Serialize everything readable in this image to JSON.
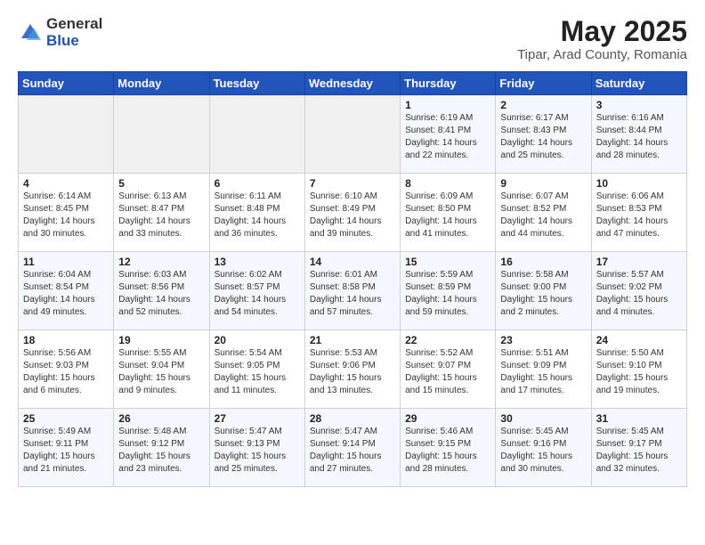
{
  "header": {
    "logo_general": "General",
    "logo_blue": "Blue",
    "title": "May 2025",
    "subtitle": "Tipar, Arad County, Romania"
  },
  "days_of_week": [
    "Sunday",
    "Monday",
    "Tuesday",
    "Wednesday",
    "Thursday",
    "Friday",
    "Saturday"
  ],
  "weeks": [
    {
      "days": [
        {
          "num": "",
          "info": ""
        },
        {
          "num": "",
          "info": ""
        },
        {
          "num": "",
          "info": ""
        },
        {
          "num": "",
          "info": ""
        },
        {
          "num": "1",
          "info": "Sunrise: 6:19 AM\nSunset: 8:41 PM\nDaylight: 14 hours\nand 22 minutes."
        },
        {
          "num": "2",
          "info": "Sunrise: 6:17 AM\nSunset: 8:43 PM\nDaylight: 14 hours\nand 25 minutes."
        },
        {
          "num": "3",
          "info": "Sunrise: 6:16 AM\nSunset: 8:44 PM\nDaylight: 14 hours\nand 28 minutes."
        }
      ]
    },
    {
      "days": [
        {
          "num": "4",
          "info": "Sunrise: 6:14 AM\nSunset: 8:45 PM\nDaylight: 14 hours\nand 30 minutes."
        },
        {
          "num": "5",
          "info": "Sunrise: 6:13 AM\nSunset: 8:47 PM\nDaylight: 14 hours\nand 33 minutes."
        },
        {
          "num": "6",
          "info": "Sunrise: 6:11 AM\nSunset: 8:48 PM\nDaylight: 14 hours\nand 36 minutes."
        },
        {
          "num": "7",
          "info": "Sunrise: 6:10 AM\nSunset: 8:49 PM\nDaylight: 14 hours\nand 39 minutes."
        },
        {
          "num": "8",
          "info": "Sunrise: 6:09 AM\nSunset: 8:50 PM\nDaylight: 14 hours\nand 41 minutes."
        },
        {
          "num": "9",
          "info": "Sunrise: 6:07 AM\nSunset: 8:52 PM\nDaylight: 14 hours\nand 44 minutes."
        },
        {
          "num": "10",
          "info": "Sunrise: 6:06 AM\nSunset: 8:53 PM\nDaylight: 14 hours\nand 47 minutes."
        }
      ]
    },
    {
      "days": [
        {
          "num": "11",
          "info": "Sunrise: 6:04 AM\nSunset: 8:54 PM\nDaylight: 14 hours\nand 49 minutes."
        },
        {
          "num": "12",
          "info": "Sunrise: 6:03 AM\nSunset: 8:56 PM\nDaylight: 14 hours\nand 52 minutes."
        },
        {
          "num": "13",
          "info": "Sunrise: 6:02 AM\nSunset: 8:57 PM\nDaylight: 14 hours\nand 54 minutes."
        },
        {
          "num": "14",
          "info": "Sunrise: 6:01 AM\nSunset: 8:58 PM\nDaylight: 14 hours\nand 57 minutes."
        },
        {
          "num": "15",
          "info": "Sunrise: 5:59 AM\nSunset: 8:59 PM\nDaylight: 14 hours\nand 59 minutes."
        },
        {
          "num": "16",
          "info": "Sunrise: 5:58 AM\nSunset: 9:00 PM\nDaylight: 15 hours\nand 2 minutes."
        },
        {
          "num": "17",
          "info": "Sunrise: 5:57 AM\nSunset: 9:02 PM\nDaylight: 15 hours\nand 4 minutes."
        }
      ]
    },
    {
      "days": [
        {
          "num": "18",
          "info": "Sunrise: 5:56 AM\nSunset: 9:03 PM\nDaylight: 15 hours\nand 6 minutes."
        },
        {
          "num": "19",
          "info": "Sunrise: 5:55 AM\nSunset: 9:04 PM\nDaylight: 15 hours\nand 9 minutes."
        },
        {
          "num": "20",
          "info": "Sunrise: 5:54 AM\nSunset: 9:05 PM\nDaylight: 15 hours\nand 11 minutes."
        },
        {
          "num": "21",
          "info": "Sunrise: 5:53 AM\nSunset: 9:06 PM\nDaylight: 15 hours\nand 13 minutes."
        },
        {
          "num": "22",
          "info": "Sunrise: 5:52 AM\nSunset: 9:07 PM\nDaylight: 15 hours\nand 15 minutes."
        },
        {
          "num": "23",
          "info": "Sunrise: 5:51 AM\nSunset: 9:09 PM\nDaylight: 15 hours\nand 17 minutes."
        },
        {
          "num": "24",
          "info": "Sunrise: 5:50 AM\nSunset: 9:10 PM\nDaylight: 15 hours\nand 19 minutes."
        }
      ]
    },
    {
      "days": [
        {
          "num": "25",
          "info": "Sunrise: 5:49 AM\nSunset: 9:11 PM\nDaylight: 15 hours\nand 21 minutes."
        },
        {
          "num": "26",
          "info": "Sunrise: 5:48 AM\nSunset: 9:12 PM\nDaylight: 15 hours\nand 23 minutes."
        },
        {
          "num": "27",
          "info": "Sunrise: 5:47 AM\nSunset: 9:13 PM\nDaylight: 15 hours\nand 25 minutes."
        },
        {
          "num": "28",
          "info": "Sunrise: 5:47 AM\nSunset: 9:14 PM\nDaylight: 15 hours\nand 27 minutes."
        },
        {
          "num": "29",
          "info": "Sunrise: 5:46 AM\nSunset: 9:15 PM\nDaylight: 15 hours\nand 28 minutes."
        },
        {
          "num": "30",
          "info": "Sunrise: 5:45 AM\nSunset: 9:16 PM\nDaylight: 15 hours\nand 30 minutes."
        },
        {
          "num": "31",
          "info": "Sunrise: 5:45 AM\nSunset: 9:17 PM\nDaylight: 15 hours\nand 32 minutes."
        }
      ]
    }
  ]
}
